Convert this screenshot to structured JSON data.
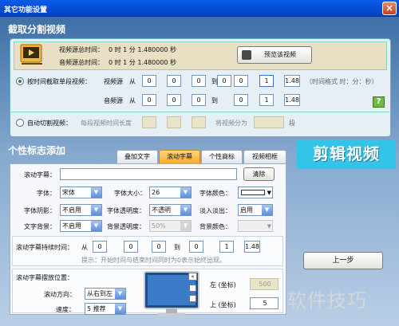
{
  "window": {
    "title": "其它功能设置",
    "close": "×"
  },
  "section1": {
    "title": "截取分割视频"
  },
  "info": {
    "video_total_label": "视频源总时间：",
    "video_total": "0  时  1  分 1.480000  秒",
    "audio_total_label": "音频源总时间：",
    "audio_total": "0  时  1  分 1.480000  秒",
    "preview_button": "预览该视频"
  },
  "timecut": {
    "radio_label": "按时间截取单段视频：",
    "video_src_label": "视频源",
    "audio_src_label": "音频源",
    "from_label": "从",
    "to_label": "到",
    "video_from": [
      "0",
      "0",
      "0",
      "0"
    ],
    "video_to": [
      "0",
      "1",
      "1.48"
    ],
    "audio_from": [
      "0",
      "0",
      "0",
      "0"
    ],
    "audio_to": [
      "0",
      "1",
      "1.48"
    ],
    "format_hint": "（时间格式 时：分：秒）",
    "help": "?"
  },
  "autocut": {
    "radio_label": "自动切割视频：",
    "each_len_label": "每段视频时间长度",
    "split_label": "将视频分为",
    "seg_unit": "段"
  },
  "section2": {
    "title": "个性标志添加"
  },
  "tabs": [
    {
      "label": "叠加文字",
      "active": false
    },
    {
      "label": "滚动字幕",
      "active": true
    },
    {
      "label": "个性商标",
      "active": false
    },
    {
      "label": "视频相框",
      "active": false
    }
  ],
  "banner": {
    "text": "剪辑视频"
  },
  "subtitle": {
    "label": "滚动字幕：",
    "text": "",
    "clear_button": "清除",
    "font_label": "字体：",
    "font": "宋体",
    "font_size_label": "字体大小：",
    "font_size": "26",
    "font_color_label": "字体颜色：",
    "shadow_label": "字体阴影：",
    "shadow": "不启用",
    "transparency_label": "字体透明度：",
    "transparency": "不透明",
    "fade_label": "淡入淡出：",
    "fade": "启用",
    "bg_label": "文字背景：",
    "bg": "不启用",
    "bg_trans_label": "背景透明度：",
    "bg_trans": "50%",
    "bg_color_label": "背景颜色：",
    "duration_label": "滚动字幕持续时间：",
    "dur_from_label": "从",
    "dur_to_label": "到",
    "dur_from": [
      "0",
      "0",
      "0"
    ],
    "dur_to": [
      "0",
      "1",
      "1.48"
    ],
    "hint": "提示：开始时间与结束时间同时为0表示始终出现。",
    "pos_label": "滚动字幕摆放位置：",
    "dir_label": "滚动方向：",
    "dir": "从右到左",
    "speed_label": "速度：",
    "speed": "5 推荐",
    "left_label": "左 (坐标)",
    "left_val": "500",
    "top_label": "上 (坐标)",
    "top_val": "5"
  },
  "prev_button": "上一步",
  "watermark": "软件技巧",
  "colors": {
    "accent": "#f6a82f",
    "title_bar": "#0a5ce6",
    "banner": "#34c4e8"
  }
}
